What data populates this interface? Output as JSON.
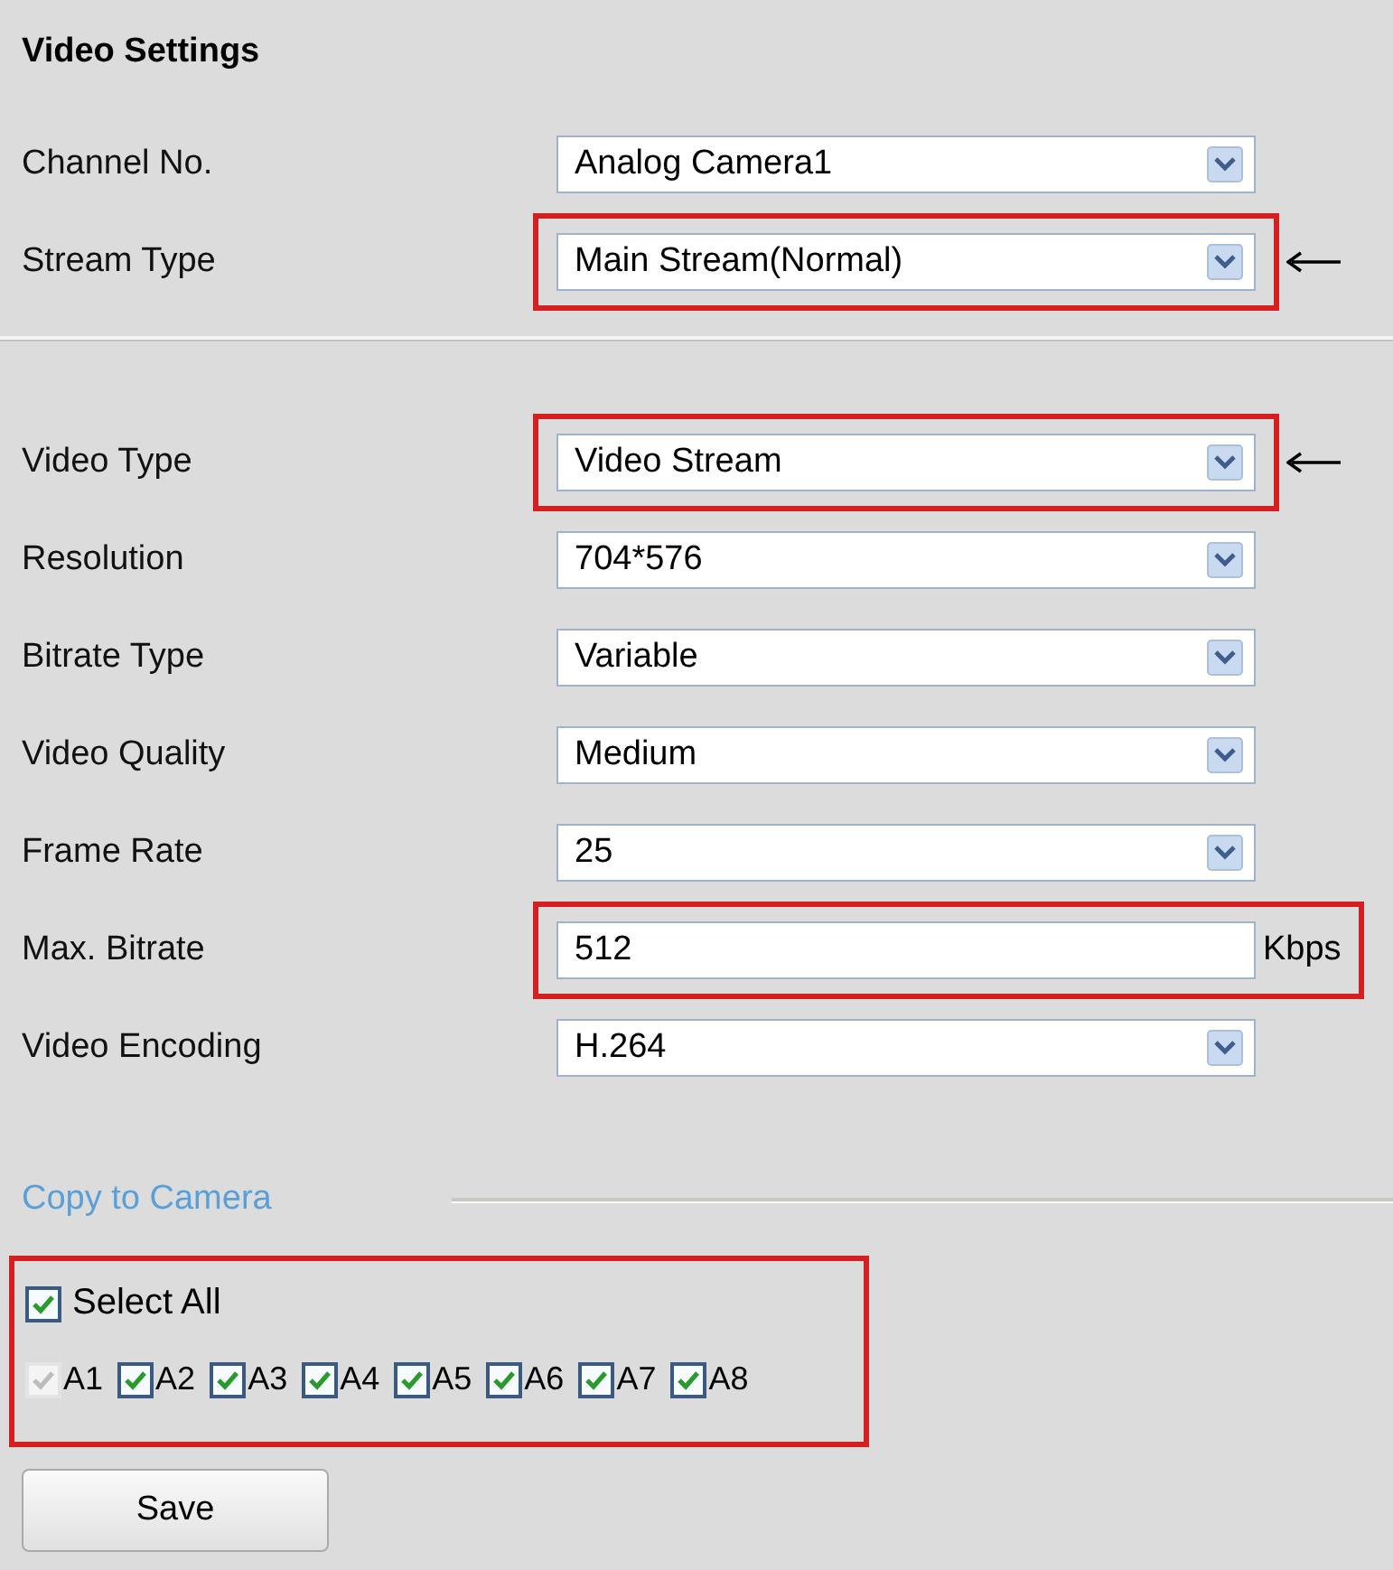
{
  "title": "Video Settings",
  "groups": [
    {
      "fields": [
        {
          "label": "Channel No.",
          "kind": "select",
          "value": "Analog Camera1",
          "highlighted": false,
          "arrow": false
        },
        {
          "label": "Stream Type",
          "kind": "select",
          "value": "Main Stream(Normal)",
          "highlighted": true,
          "arrow": true
        }
      ]
    },
    {
      "fields": [
        {
          "label": "Video Type",
          "kind": "select",
          "value": "Video Stream",
          "highlighted": true,
          "arrow": true
        },
        {
          "label": "Resolution",
          "kind": "select",
          "value": "704*576",
          "highlighted": false,
          "arrow": false
        },
        {
          "label": "Bitrate Type",
          "kind": "select",
          "value": "Variable",
          "highlighted": false,
          "arrow": false
        },
        {
          "label": "Video Quality",
          "kind": "select",
          "value": "Medium",
          "highlighted": false,
          "arrow": false
        },
        {
          "label": "Frame Rate",
          "kind": "select",
          "value": "25",
          "highlighted": false,
          "arrow": false
        },
        {
          "label": "Max. Bitrate",
          "kind": "text",
          "value": "512",
          "unit": "Kbps",
          "highlighted": true,
          "arrow": false
        },
        {
          "label": "Video Encoding",
          "kind": "select",
          "value": "H.264",
          "highlighted": false,
          "arrow": false
        }
      ]
    }
  ],
  "copy": {
    "heading": "Copy to Camera",
    "highlighted": true,
    "select_all": {
      "label": "Select All",
      "checked": true
    },
    "cameras": [
      {
        "label": "A1",
        "checked": true,
        "disabled": true
      },
      {
        "label": "A2",
        "checked": true,
        "disabled": false
      },
      {
        "label": "A3",
        "checked": true,
        "disabled": false
      },
      {
        "label": "A4",
        "checked": true,
        "disabled": false
      },
      {
        "label": "A5",
        "checked": true,
        "disabled": false
      },
      {
        "label": "A6",
        "checked": true,
        "disabled": false
      },
      {
        "label": "A7",
        "checked": true,
        "disabled": false
      },
      {
        "label": "A8",
        "checked": true,
        "disabled": false
      }
    ]
  },
  "save_button": "Save"
}
